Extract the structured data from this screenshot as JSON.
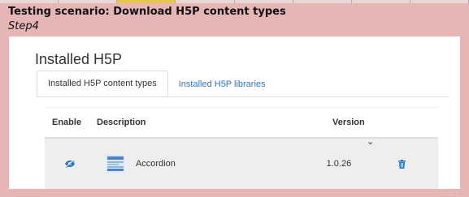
{
  "header": {
    "scenario": "Testing scenario: Download H5P content types",
    "step": "Step4"
  },
  "page": {
    "title": "Installed H5P",
    "tabs": [
      {
        "label": "Installed H5P content types",
        "active": true
      },
      {
        "label": "Installed H5P libraries",
        "active": false
      }
    ]
  },
  "table": {
    "headers": {
      "enable": "Enable",
      "description": "Description",
      "version": "Version"
    },
    "rows": [
      {
        "name": "Accordion",
        "version": "1.0.26",
        "enable_icon": "eye-slash-icon",
        "type_icon": "accordion-icon",
        "action_icon": "trash-icon"
      }
    ]
  },
  "colors": {
    "background": "#e6b6b6",
    "link": "#2a78c2",
    "row_bg": "#eeeeee",
    "active_tab_marker": "#e7c64d"
  }
}
